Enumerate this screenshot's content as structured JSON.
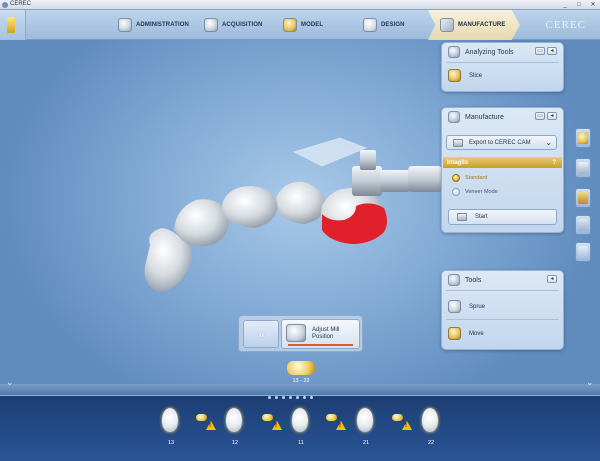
{
  "window": {
    "title": "CEREC",
    "controls": [
      "_",
      "□",
      "✕"
    ]
  },
  "phases": [
    {
      "label": "ADMINISTRATION",
      "icon": "administration-icon"
    },
    {
      "label": "ACQUISITION",
      "icon": "acquisition-icon"
    },
    {
      "label": "MODEL",
      "icon": "model-icon"
    },
    {
      "label": "DESIGN",
      "icon": "design-icon"
    },
    {
      "label": "MANUFACTURE",
      "icon": "manufacture-icon",
      "active": true
    }
  ],
  "brand": "CEREC",
  "analyzing_tools": {
    "title": "Analyzing Tools",
    "items": [
      {
        "label": "Slice",
        "icon": "slice-icon"
      }
    ]
  },
  "manufacture": {
    "title": "Manufacture",
    "dropdown": "Export to CEREC CAM",
    "section": "Intaglio",
    "help": "?",
    "options": [
      {
        "label": "Standard",
        "selected": true
      },
      {
        "label": "Veneer Mode",
        "selected": false
      }
    ],
    "start_label": "Start"
  },
  "tools": {
    "title": "Tools",
    "items": [
      {
        "label": "Sprue",
        "icon": "sprue-icon"
      },
      {
        "label": "Move",
        "icon": "move-icon"
      }
    ]
  },
  "adjust_mill": {
    "back_glyph": "«",
    "label": "Adjust Mill Position"
  },
  "current_restoration": {
    "label": "13 - 22"
  },
  "teeth_strip": [
    "13",
    "12",
    "11",
    "21",
    "22"
  ],
  "colors": {
    "accent_gold": "#e6bd4a",
    "highlight_red": "#e0202a",
    "bottom_bar": "#1d3e73"
  }
}
